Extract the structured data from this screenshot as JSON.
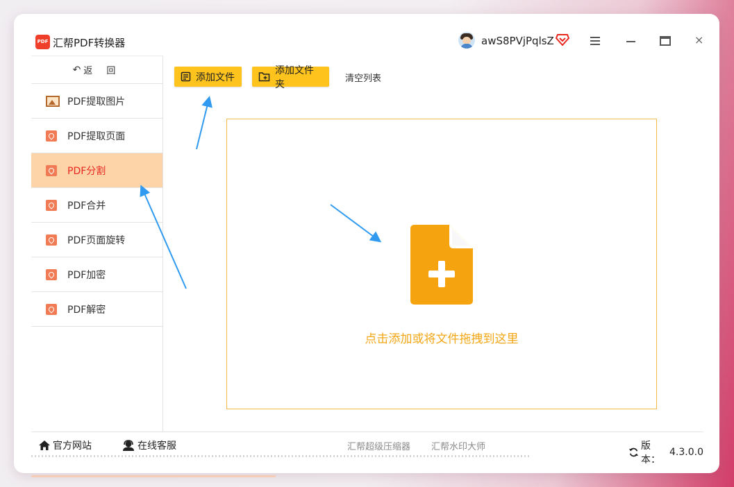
{
  "app": {
    "logo_text": "PDF",
    "title": "汇帮PDF转换器"
  },
  "user": {
    "name": "awS8PVjPqlsZ"
  },
  "window_controls": {
    "close_glyph": "×"
  },
  "sidebar": {
    "back_label": "返 回",
    "items": [
      {
        "label": "PDF提取图片",
        "icon": "image-icon",
        "active": false
      },
      {
        "label": "PDF提取页面",
        "icon": "pdf-icon",
        "active": false
      },
      {
        "label": "PDF分割",
        "icon": "pdf-icon",
        "active": true
      },
      {
        "label": "PDF合并",
        "icon": "pdf-icon",
        "active": false
      },
      {
        "label": "PDF页面旋转",
        "icon": "pdf-icon",
        "active": false
      },
      {
        "label": "PDF加密",
        "icon": "pdf-icon",
        "active": false
      },
      {
        "label": "PDF解密",
        "icon": "pdf-icon",
        "active": false
      }
    ]
  },
  "toolbar": {
    "add_file_label": "添加文件",
    "add_folder_label": "添加文件夹",
    "clear_list_label": "清空列表"
  },
  "dropzone": {
    "hint": "点击添加或将文件拖拽到这里"
  },
  "footer": {
    "official_site": "官方网站",
    "online_service": "在线客服",
    "compressor": "汇帮超级压缩器",
    "watermark": "汇帮水印大师",
    "version_label": "版本：",
    "version_value": "4.3.0.0"
  },
  "colors": {
    "accent_yellow": "#ffc31d",
    "active_bg": "#fdd3a8",
    "active_text": "#e8271e",
    "drop_border": "#f2b84a",
    "drop_text": "#f3a716",
    "arrow_blue": "#2f9af0"
  }
}
